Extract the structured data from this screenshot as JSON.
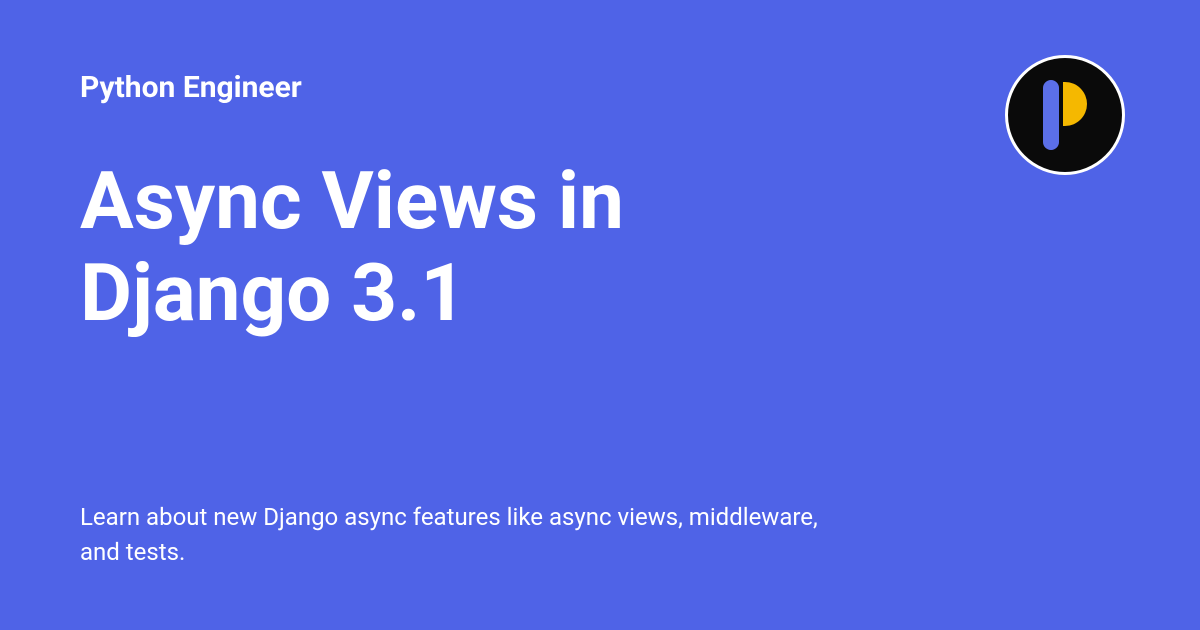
{
  "site_name": "Python Engineer",
  "title": "Async Views in Django 3.1",
  "description": "Learn about new Django async features like async views, middleware, and tests.",
  "colors": {
    "background": "#4F63E7",
    "text": "#ffffff",
    "logo_bg": "#0a0a0a",
    "logo_bar": "#5B6FE8",
    "logo_accent": "#F5B800"
  }
}
